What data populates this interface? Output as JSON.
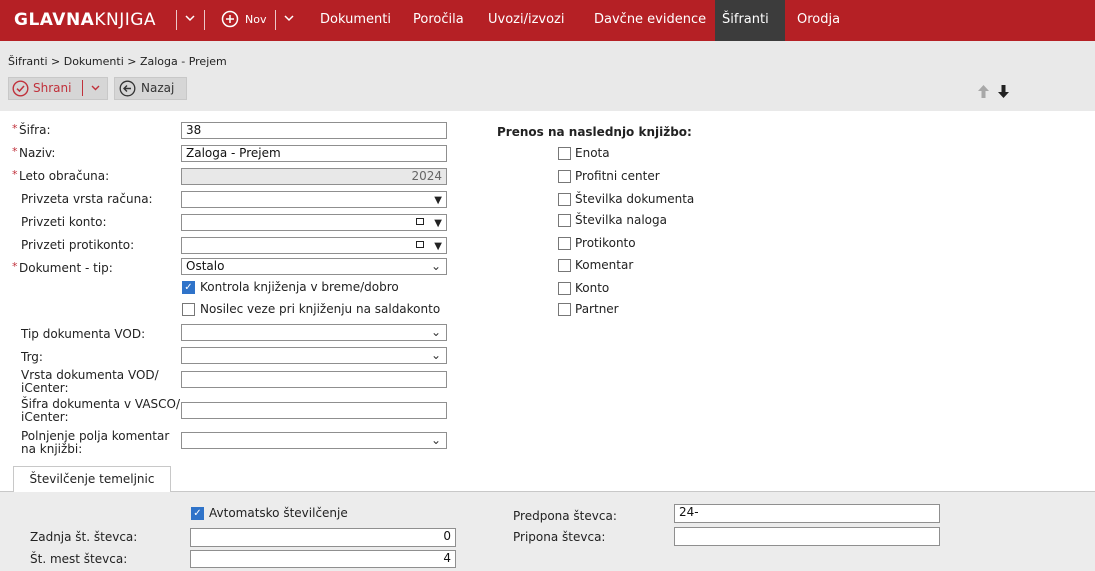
{
  "brand": {
    "bold": "GLAVNA",
    "light": "KNJIGA"
  },
  "nav": {
    "new_label": "Nov",
    "items": [
      "Dokumenti",
      "Poročila",
      "Uvozi/izvozi",
      "Davčne evidence",
      "Šifranti",
      "Orodja"
    ],
    "active": "Šifranti"
  },
  "breadcrumb": "Šifranti > Dokumenti > Zaloga - Prejem",
  "toolbar": {
    "save_label": "Shrani",
    "back_label": "Nazaj"
  },
  "icons": [
    "logo-chevron-down-icon",
    "plus-circle-icon",
    "chevron-down-icon",
    "check-circle-icon",
    "arrow-left-circle-icon",
    "arrow-up-icon",
    "arrow-down-icon",
    "calendar-icon"
  ],
  "colors": {
    "brand_red": "#b52025",
    "active_tab": "#3c3c3c",
    "accent_red": "#c0313b",
    "checkbox_blue": "#2f73c9"
  },
  "form": {
    "sifra": {
      "label": "Šifra:",
      "value": "38"
    },
    "naziv": {
      "label": "Naziv:",
      "value": "Zaloga - Prejem"
    },
    "leto": {
      "label": "Leto obračuna:",
      "value": "2024"
    },
    "vrsta_racuna": {
      "label": "Privzeta vrsta računa:",
      "value": ""
    },
    "konto": {
      "label": "Privzeti konto:",
      "value": ""
    },
    "protikonto": {
      "label": "Privzeti protikonto:",
      "value": ""
    },
    "dokument_tip": {
      "label": "Dokument - tip:",
      "value": "Ostalo"
    },
    "kontrola": {
      "label": "Kontrola knjiženja v breme/dobro",
      "checked": true
    },
    "nosilec": {
      "label": "Nosilec veze pri knjiženju na saldakonto",
      "checked": false
    },
    "tip_vod": {
      "label": "Tip dokumenta VOD:",
      "value": ""
    },
    "trg": {
      "label": "Trg:",
      "value": ""
    },
    "vrsta_vod": {
      "label1": "Vrsta dokumenta VOD/",
      "label2": "iCenter:",
      "value": ""
    },
    "sifra_vasco": {
      "label1": "Šifra dokumenta v VASCO/",
      "label2": "iCenter:",
      "value": ""
    },
    "komentar": {
      "label1": "Polnjenje polja komentar",
      "label2": "na knjižbi:",
      "value": ""
    }
  },
  "prenos": {
    "title": "Prenos na naslednjo knjižbo:",
    "items": [
      "Enota",
      "Profitni center",
      "Številka dokumenta",
      "Številka naloga",
      "Protikonto",
      "Komentar",
      "Konto",
      "Partner"
    ]
  },
  "tab": {
    "label": "Številčenje temeljnic",
    "avto": {
      "label": "Avtomatsko številčenje",
      "checked": true
    },
    "zadnja": {
      "label": "Zadnja št. števca:",
      "value": "0"
    },
    "mest": {
      "label": "Št. mest števca:",
      "value": "4"
    },
    "predpona": {
      "label": "Predpona števca:",
      "value": "24-"
    },
    "pripona": {
      "label": "Pripona števca:",
      "value": ""
    }
  }
}
